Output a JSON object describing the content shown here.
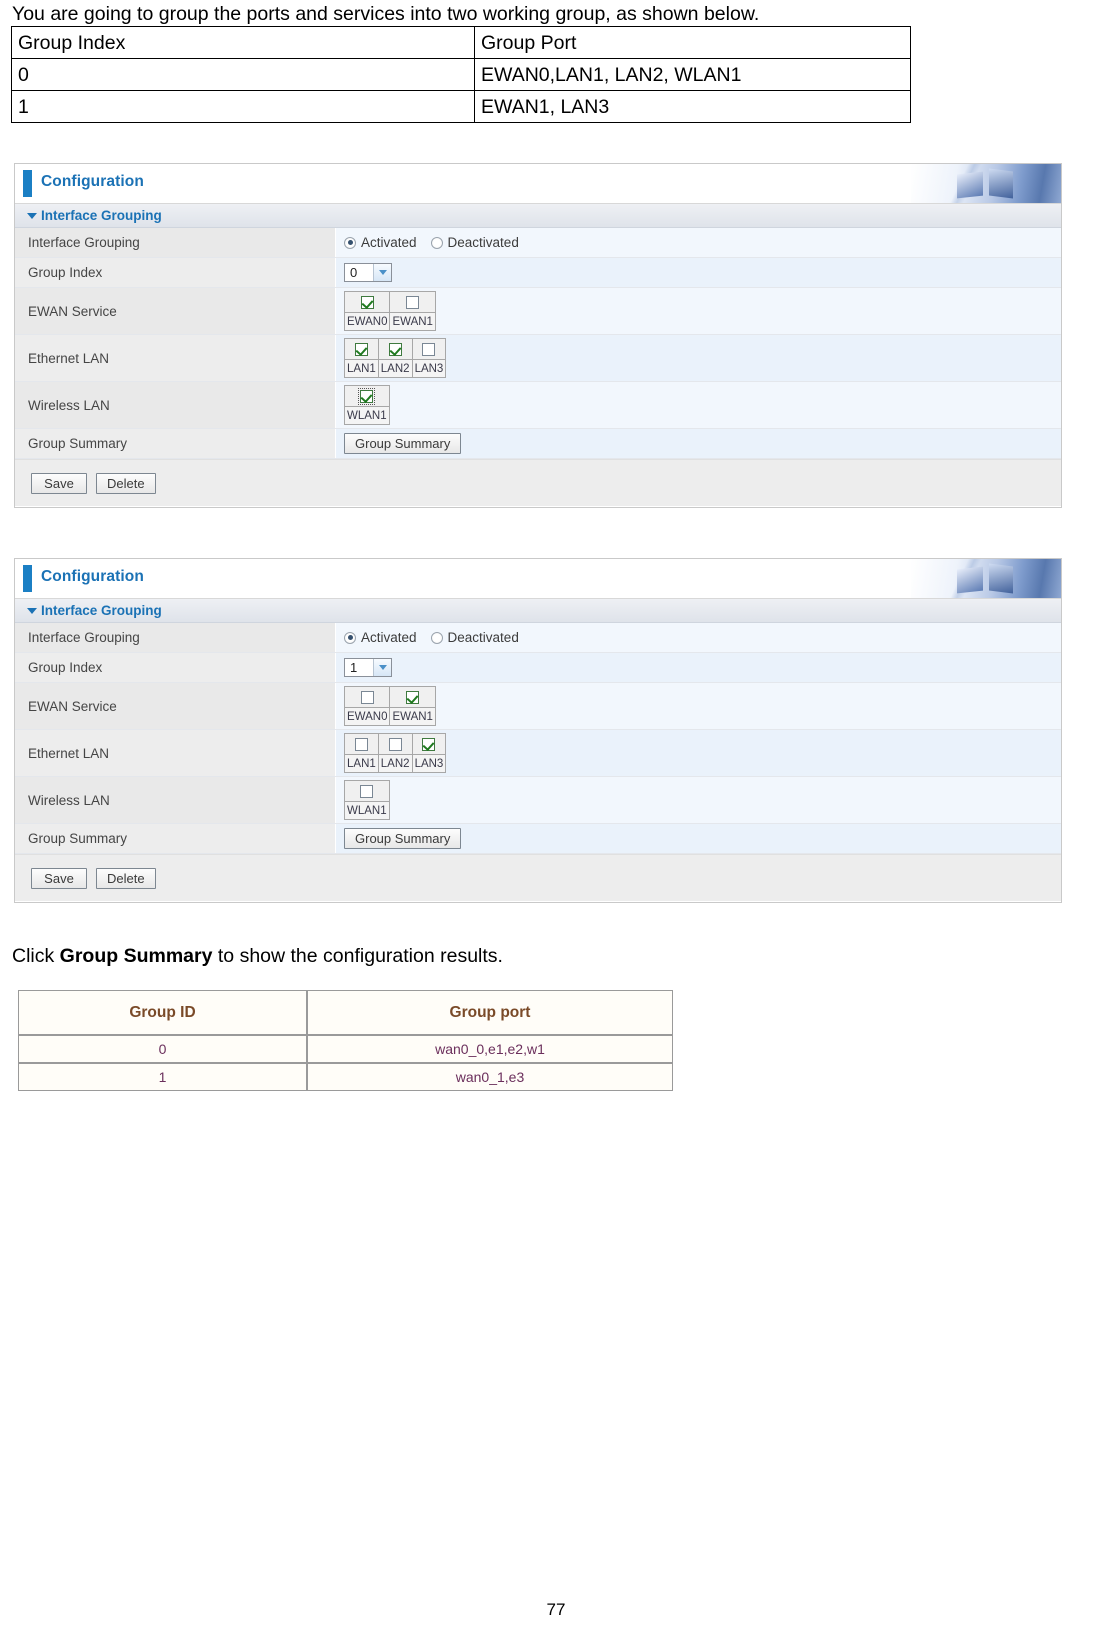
{
  "intro": {
    "text": "You are going to group the ports and services into two working group, as shown below."
  },
  "doc_table": {
    "headers": [
      "Group Index",
      "Group Port"
    ],
    "rows": [
      [
        "0",
        "EWAN0,LAN1, LAN2, WLAN1"
      ],
      [
        "1",
        "EWAN1, LAN3"
      ]
    ]
  },
  "panels": [
    {
      "title": "Configuration",
      "section": "Interface Grouping",
      "rows": {
        "interface_grouping": {
          "label": "Interface Grouping",
          "options": [
            "Activated",
            "Deactivated"
          ],
          "selected": "Activated"
        },
        "group_index": {
          "label": "Group Index",
          "value": "0"
        },
        "ewan_service": {
          "label": "EWAN Service",
          "ports": [
            {
              "name": "EWAN0",
              "checked": true
            },
            {
              "name": "EWAN1",
              "checked": false
            }
          ]
        },
        "ethernet_lan": {
          "label": "Ethernet LAN",
          "ports": [
            {
              "name": "LAN1",
              "checked": true
            },
            {
              "name": "LAN2",
              "checked": true
            },
            {
              "name": "LAN3",
              "checked": false
            }
          ]
        },
        "wireless_lan": {
          "label": "Wireless LAN",
          "ports": [
            {
              "name": "WLAN1",
              "checked": true,
              "focused": true
            }
          ]
        },
        "group_summary": {
          "label": "Group Summary",
          "button": "Group Summary"
        }
      },
      "buttons": {
        "save": "Save",
        "delete": "Delete"
      }
    },
    {
      "title": "Configuration",
      "section": "Interface Grouping",
      "rows": {
        "interface_grouping": {
          "label": "Interface Grouping",
          "options": [
            "Activated",
            "Deactivated"
          ],
          "selected": "Activated"
        },
        "group_index": {
          "label": "Group Index",
          "value": "1"
        },
        "ewan_service": {
          "label": "EWAN Service",
          "ports": [
            {
              "name": "EWAN0",
              "checked": false
            },
            {
              "name": "EWAN1",
              "checked": true
            }
          ]
        },
        "ethernet_lan": {
          "label": "Ethernet LAN",
          "ports": [
            {
              "name": "LAN1",
              "checked": false
            },
            {
              "name": "LAN2",
              "checked": false
            },
            {
              "name": "LAN3",
              "checked": true
            }
          ]
        },
        "wireless_lan": {
          "label": "Wireless LAN",
          "ports": [
            {
              "name": "WLAN1",
              "checked": false,
              "focused": false
            }
          ]
        },
        "group_summary": {
          "label": "Group Summary",
          "button": "Group Summary"
        }
      },
      "buttons": {
        "save": "Save",
        "delete": "Delete"
      }
    }
  ],
  "click_line": {
    "prefix": "Click ",
    "bold": "Group Summary",
    "suffix": " to show the configuration results."
  },
  "summary_table": {
    "headers": [
      "Group ID",
      "Group port"
    ],
    "rows": [
      [
        "0",
        "wan0_0,e1,e2,w1"
      ],
      [
        "1",
        "wan0_1,e3"
      ]
    ]
  },
  "page_number": "77",
  "colors": {
    "accent": "#1b72b5",
    "label_bg": "#e9e9e9",
    "value_bg": "#f2f7fd",
    "summary_header": "#7a4a28",
    "summary_cell": "#6b2f5c"
  }
}
